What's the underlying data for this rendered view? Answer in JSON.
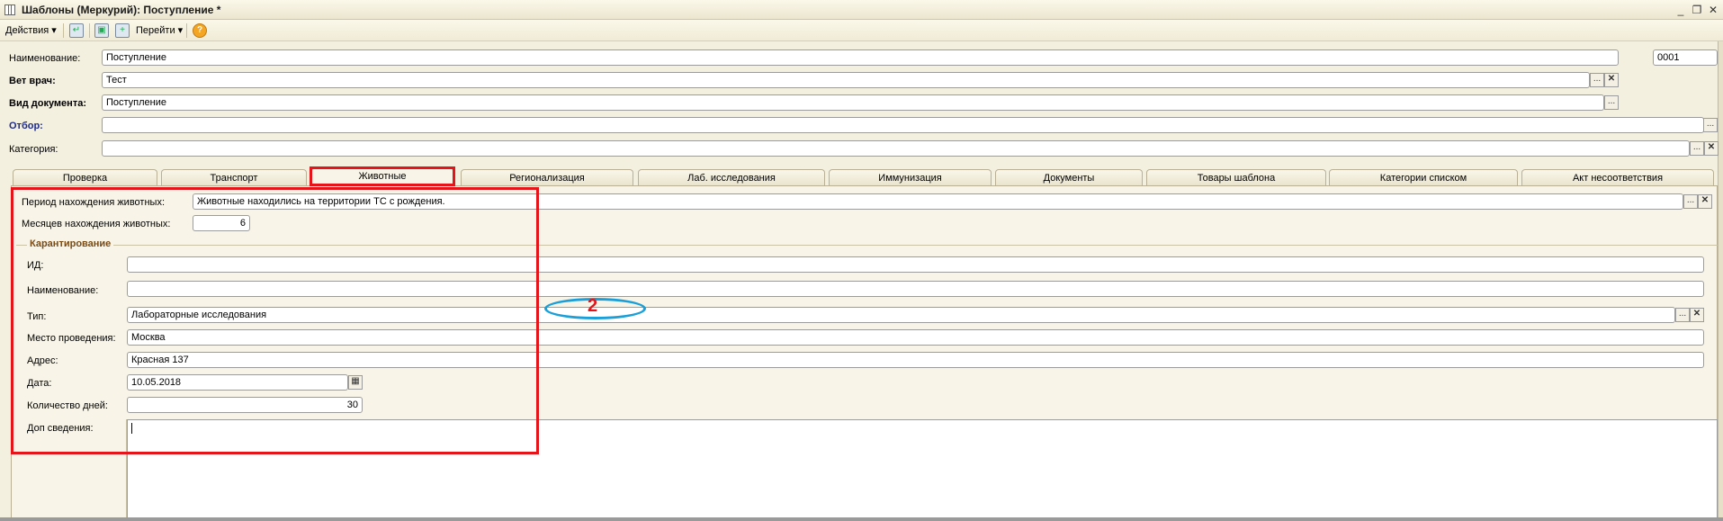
{
  "window": {
    "title": "Шаблоны (Меркурий): Поступление *"
  },
  "toolbar": {
    "actions": "Действия",
    "goto": "Перейти",
    "help": "?"
  },
  "header": {
    "name_label": "Наименование:",
    "name_value": "Поступление",
    "code_value": "0001",
    "vet_label": "Вет врач:",
    "vet_value": "Тест",
    "doctype_label": "Вид документа:",
    "doctype_value": "Поступление",
    "filter_label": "Отбор:",
    "filter_value": "",
    "category_label": "Категория:",
    "category_value": ""
  },
  "buttons": {
    "ellipsis": "...",
    "clear": "✕"
  },
  "tabs": [
    {
      "label": "Проверка"
    },
    {
      "label": "Транспорт"
    },
    {
      "label": "Животные"
    },
    {
      "label": "Регионализация"
    },
    {
      "label": "Лаб. исследования"
    },
    {
      "label": "Иммунизация"
    },
    {
      "label": "Документы"
    },
    {
      "label": "Товары шаблона"
    },
    {
      "label": "Категории списком"
    },
    {
      "label": "Акт несоответствия"
    }
  ],
  "animals": {
    "period_label": "Период нахождения животных:",
    "period_value": "Животные находились на территории ТС с рождения.",
    "months_label": "Месяцев нахождения животных:",
    "months_value": "6",
    "quarantine_title": "Карантирование",
    "id_label": "ИД:",
    "id_value": "",
    "name_label": "Наименование:",
    "name_value": "",
    "type_label": "Тип:",
    "type_value": "Лабораторные исследования",
    "place_label": "Место проведения:",
    "place_value": "Москва",
    "address_label": "Адрес:",
    "address_value": "Красная 137",
    "date_label": "Дата:",
    "date_value": "10.05.2018",
    "days_label": "Количество дней:",
    "days_value": "30",
    "info_label": "Доп сведения:",
    "info_value": ""
  },
  "annotation": {
    "number": "2",
    "box_color": "#e4141a",
    "ellipse_color": "#1a9fd8"
  }
}
